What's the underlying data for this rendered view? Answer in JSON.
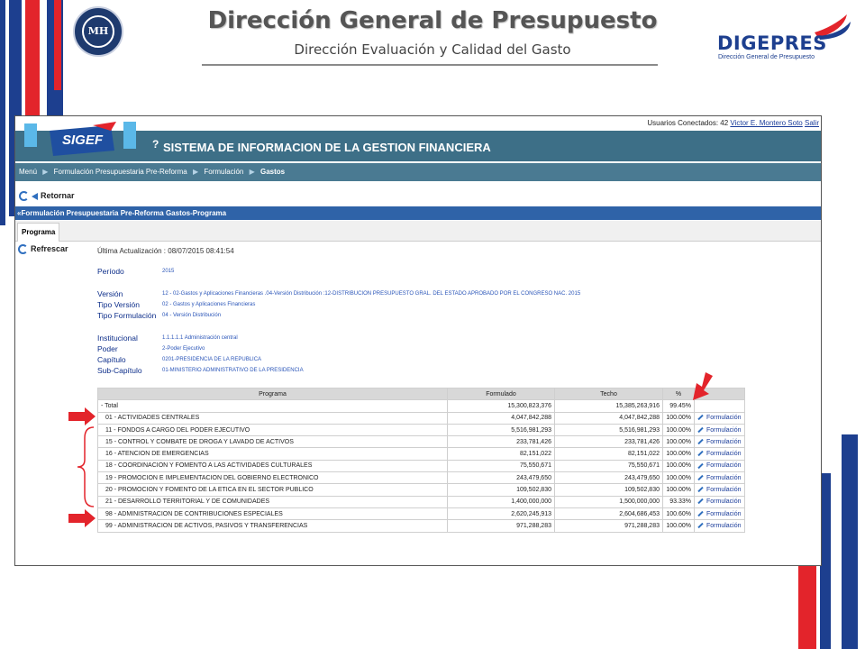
{
  "slide": {
    "title": "Dirección General de Presupuesto",
    "subtitle": "Dirección Evaluación y Calidad del Gasto",
    "seal_text": "MH",
    "logo_name": "DIGEPRES",
    "logo_tagline": "Dirección General de Presupuesto"
  },
  "colors": {
    "accent_blue": "#1d3f8f",
    "accent_red": "#e3242b",
    "app_header": "#3d6f87",
    "section_bar": "#2f63a8"
  },
  "app": {
    "connected_label": "Usuarios Conectados: 42",
    "user_name": "Victor E. Montero Soto",
    "user_suffix": "Salir",
    "logo_text": "SIGEF",
    "help_icon": "?",
    "system_title": "SISTEMA DE INFORMACION DE LA GESTION FINANCIERA",
    "breadcrumb": [
      "Menú",
      "Formulación Presupuestaria Pre-Reforma",
      "Formulación",
      "Gastos"
    ],
    "back_label": "Retornar",
    "section_title": "«Formulación Presupuestaria Pre-Reforma Gastos-Programa",
    "tab_label": "Programa",
    "refresh_label": "Refrescar",
    "last_update": "Última Actualización : 08/07/2015 08:41:54"
  },
  "fields": {
    "periodo": {
      "label": "Período",
      "value": "2015"
    },
    "version": {
      "label": "Versión",
      "value": "12 - 02-Gastos y Aplicaciones Financieras .04-Versión Distribución :12-DISTRIBUCION PRESUPUESTO GRAL. DEL ESTADO APROBADO POR EL CONGRESO NAC. 2015"
    },
    "tipo_version": {
      "label": "Tipo Versión",
      "value": "02 - Gastos y Aplicaciones Financieras"
    },
    "tipo_formulacion": {
      "label": "Tipo Formulación",
      "value": "04 - Versión Distribución"
    },
    "institucional": {
      "label": "Institucional",
      "value": "1.1.1.1.1 Administración central"
    },
    "poder": {
      "label": "Poder",
      "value": "2-Poder Ejecutivo"
    },
    "capitulo": {
      "label": "Capítulo",
      "value": "0201-PRESIDENCIA DE LA REPUBLICA"
    },
    "subcapitulo": {
      "label": "Sub-Capítulo",
      "value": "01-MINISTERIO ADMINISTRATIVO DE LA PRESIDENCIA"
    }
  },
  "table": {
    "headers": [
      "Programa",
      "Formulado",
      "Techo",
      "%",
      ""
    ],
    "action_label": "Formulación",
    "rows": [
      {
        "programa": "- Total",
        "formulado": "15,300,823,376",
        "techo": "15,385,263,916",
        "pct": "99.45%",
        "action": false
      },
      {
        "programa": "01 - ACTIVIDADES CENTRALES",
        "formulado": "4,047,842,288",
        "techo": "4,047,842,288",
        "pct": "100.00%",
        "action": true
      },
      {
        "programa": "11 - FONDOS A CARGO DEL PODER EJECUTIVO",
        "formulado": "5,516,981,293",
        "techo": "5,516,981,293",
        "pct": "100.00%",
        "action": true
      },
      {
        "programa": "15 - CONTROL Y COMBATE DE DROGA Y LAVADO DE ACTIVOS",
        "formulado": "233,781,426",
        "techo": "233,781,426",
        "pct": "100.00%",
        "action": true
      },
      {
        "programa": "16 - ATENCION DE EMERGENCIAS",
        "formulado": "82,151,022",
        "techo": "82,151,022",
        "pct": "100.00%",
        "action": true
      },
      {
        "programa": "18 - COORDINACION Y FOMENTO A LAS ACTIVIDADES CULTURALES",
        "formulado": "75,550,671",
        "techo": "75,550,671",
        "pct": "100.00%",
        "action": true
      },
      {
        "programa": "19 - PROMOCION E IMPLEMENTACION DEL GOBIERNO ELECTRONICO",
        "formulado": "243,479,650",
        "techo": "243,479,650",
        "pct": "100.00%",
        "action": true
      },
      {
        "programa": "20 - PROMOCION Y FOMENTO DE LA ETICA EN EL SECTOR PUBLICO",
        "formulado": "109,502,830",
        "techo": "109,502,830",
        "pct": "100.00%",
        "action": true
      },
      {
        "programa": "21 - DESARROLLO TERRITORIAL Y DE COMUNIDADES",
        "formulado": "1,400,000,000",
        "techo": "1,500,000,000",
        "pct": "93.33%",
        "action": true
      },
      {
        "programa": "98 - ADMINISTRACION DE CONTRIBUCIONES ESPECIALES",
        "formulado": "2,620,245,913",
        "techo": "2,604,686,453",
        "pct": "100.60%",
        "action": true
      },
      {
        "programa": "99 - ADMINISTRACION DE ACTIVOS, PASIVOS Y TRANSFERENCIAS",
        "formulado": "971,288,283",
        "techo": "971,288,283",
        "pct": "100.00%",
        "action": true
      }
    ]
  }
}
